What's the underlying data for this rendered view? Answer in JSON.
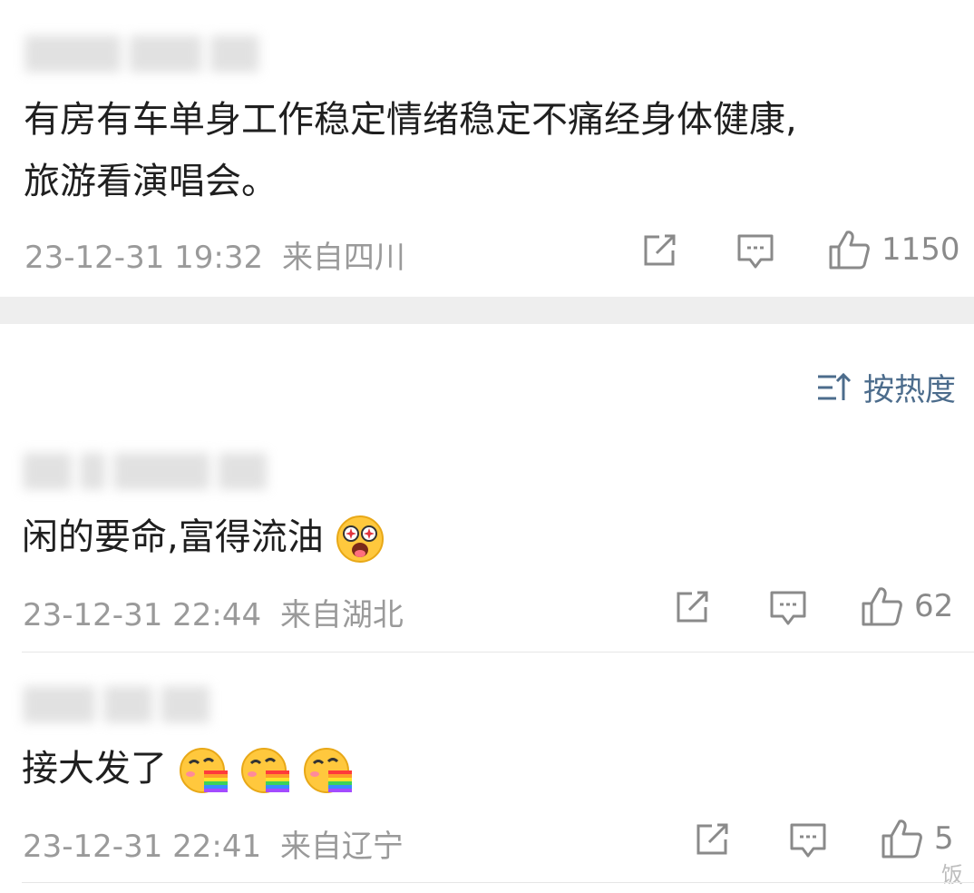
{
  "comments": [
    {
      "text_line1": "有房有车单身工作稳定情绪稳定不痛经身体健康,",
      "text_line2": "旅游看演唱会。",
      "time": "23-12-31 19:32",
      "location": "来自四川",
      "likes": "1150"
    },
    {
      "text": "闲的要命,富得流油",
      "time": "23-12-31 22:44",
      "location": "来自湖北",
      "likes": "62",
      "emoji": "drooling-star-eyes-icon"
    },
    {
      "text": "接大发了",
      "time": "23-12-31 22:41",
      "location": "来自辽宁",
      "likes": "5",
      "emoji": "rainbow-vomit-icon"
    }
  ],
  "sort": {
    "label": "按热度"
  },
  "watermark": {
    "text": "饭"
  },
  "colors": {
    "accent": "#4c6c8c",
    "meta": "#9a9a9a",
    "separator": "#eeeeee"
  }
}
